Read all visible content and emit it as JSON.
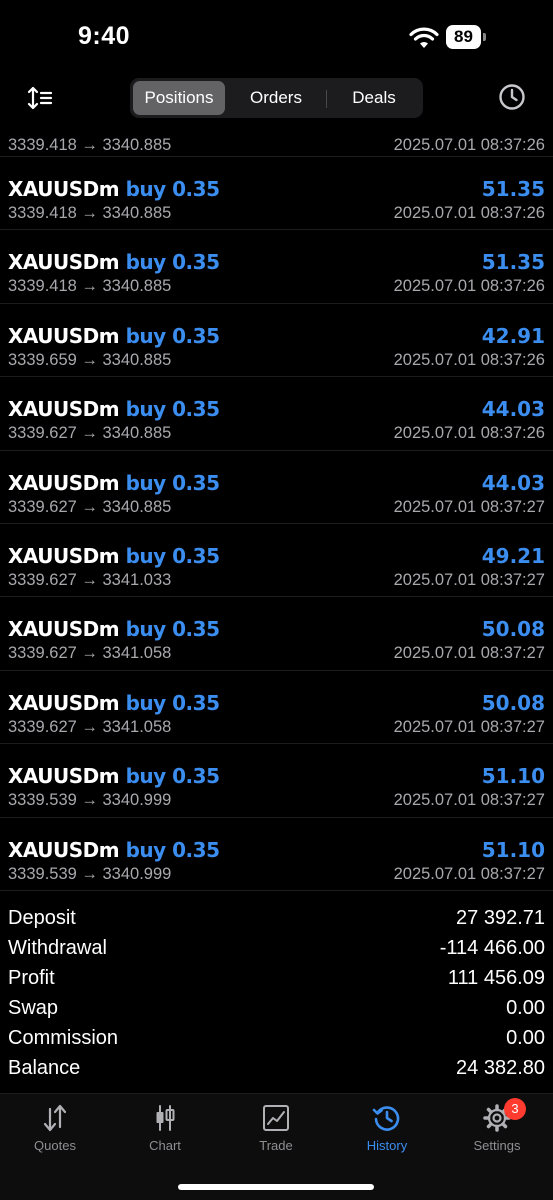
{
  "status": {
    "time": "9:40",
    "battery": "89"
  },
  "toolbar": {
    "tabs": [
      {
        "label": "Positions",
        "active": true
      },
      {
        "label": "Orders",
        "active": false
      },
      {
        "label": "Deals",
        "active": false
      }
    ]
  },
  "partial_row": {
    "prices": "3339.418 → 3340.885",
    "time": "2025.07.01 08:37:26"
  },
  "deals": [
    {
      "symbol": "XAUUSDm",
      "side": "buy 0.35",
      "profit": "51.35",
      "prices": "3339.418 → 3340.885",
      "time": "2025.07.01 08:37:26"
    },
    {
      "symbol": "XAUUSDm",
      "side": "buy 0.35",
      "profit": "51.35",
      "prices": "3339.418 → 3340.885",
      "time": "2025.07.01 08:37:26"
    },
    {
      "symbol": "XAUUSDm",
      "side": "buy 0.35",
      "profit": "42.91",
      "prices": "3339.659 → 3340.885",
      "time": "2025.07.01 08:37:26"
    },
    {
      "symbol": "XAUUSDm",
      "side": "buy 0.35",
      "profit": "44.03",
      "prices": "3339.627 → 3340.885",
      "time": "2025.07.01 08:37:26"
    },
    {
      "symbol": "XAUUSDm",
      "side": "buy 0.35",
      "profit": "44.03",
      "prices": "3339.627 → 3340.885",
      "time": "2025.07.01 08:37:27"
    },
    {
      "symbol": "XAUUSDm",
      "side": "buy 0.35",
      "profit": "49.21",
      "prices": "3339.627 → 3341.033",
      "time": "2025.07.01 08:37:27"
    },
    {
      "symbol": "XAUUSDm",
      "side": "buy 0.35",
      "profit": "50.08",
      "prices": "3339.627 → 3341.058",
      "time": "2025.07.01 08:37:27"
    },
    {
      "symbol": "XAUUSDm",
      "side": "buy 0.35",
      "profit": "50.08",
      "prices": "3339.627 → 3341.058",
      "time": "2025.07.01 08:37:27"
    },
    {
      "symbol": "XAUUSDm",
      "side": "buy 0.35",
      "profit": "51.10",
      "prices": "3339.539 → 3340.999",
      "time": "2025.07.01 08:37:27"
    },
    {
      "symbol": "XAUUSDm",
      "side": "buy 0.35",
      "profit": "51.10",
      "prices": "3339.539 → 3340.999",
      "time": "2025.07.01 08:37:27"
    }
  ],
  "summary": [
    {
      "label": "Deposit",
      "value": "27 392.71"
    },
    {
      "label": "Withdrawal",
      "value": "-114 466.00"
    },
    {
      "label": "Profit",
      "value": "111 456.09"
    },
    {
      "label": "Swap",
      "value": "0.00"
    },
    {
      "label": "Commission",
      "value": "0.00"
    },
    {
      "label": "Balance",
      "value": "24 382.80"
    }
  ],
  "tabbar": {
    "items": [
      {
        "label": "Quotes",
        "icon": "quotes-arrows-icon"
      },
      {
        "label": "Chart",
        "icon": "candlestick-icon"
      },
      {
        "label": "Trade",
        "icon": "trade-chart-icon"
      },
      {
        "label": "History",
        "icon": "history-clock-icon",
        "active": true
      },
      {
        "label": "Settings",
        "icon": "gear-icon",
        "badge": "3"
      }
    ]
  },
  "colors": {
    "accent": "#3b8ef0",
    "background": "#000000",
    "muted": "#a8a8ad",
    "badge": "#ff3b30"
  }
}
